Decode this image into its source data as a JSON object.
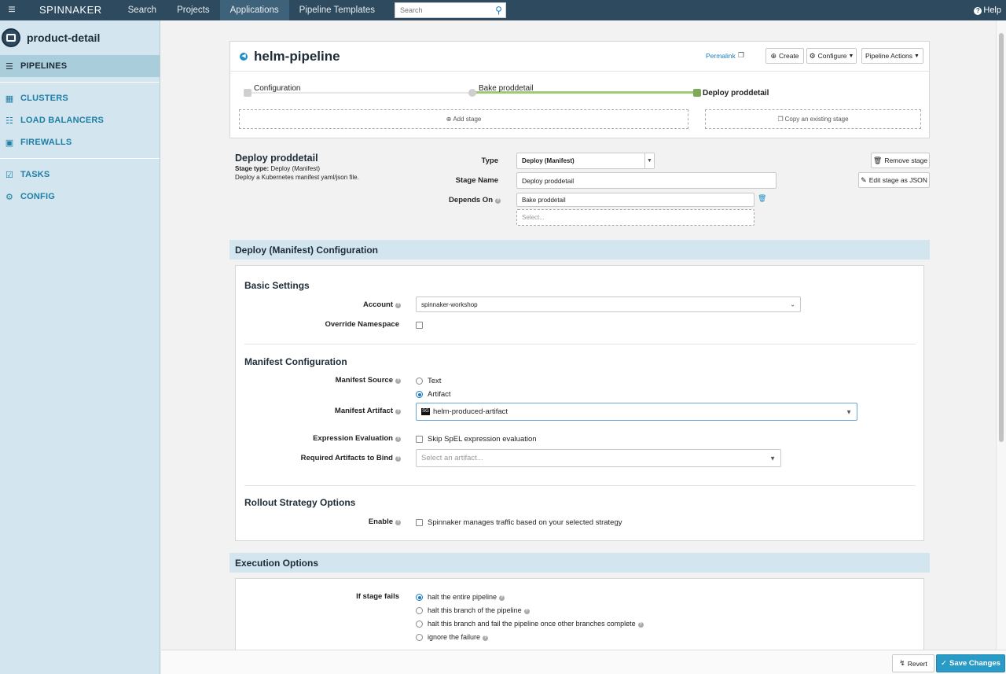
{
  "topnav": {
    "brand": "SPINNAKER",
    "items": [
      "Search",
      "Projects",
      "Applications",
      "Pipeline Templates"
    ],
    "active_item": "Applications",
    "search_placeholder": "Search",
    "help": "Help"
  },
  "sidebar": {
    "app_name": "product-detail",
    "items": [
      {
        "label": "PIPELINES",
        "icon": "list-icon"
      },
      {
        "label": "CLUSTERS",
        "icon": "grid-icon"
      },
      {
        "label": "LOAD BALANCERS",
        "icon": "sitemap-icon"
      },
      {
        "label": "FIREWALLS",
        "icon": "lock-icon"
      },
      {
        "label": "TASKS",
        "icon": "check-square-icon"
      },
      {
        "label": "CONFIG",
        "icon": "gear-icon"
      }
    ]
  },
  "pipeline": {
    "name": "helm-pipeline",
    "permalink": "Permalink",
    "create": "Create",
    "configure": "Configure",
    "actions": "Pipeline Actions",
    "stages": [
      {
        "label": "Configuration"
      },
      {
        "label": "Bake proddetail"
      },
      {
        "label": "Deploy proddetail"
      }
    ],
    "add_stage": "Add stage",
    "copy_stage": "Copy an existing stage"
  },
  "stage": {
    "title": "Deploy proddetail",
    "type_label": "Stage type:",
    "type_value": "Deploy (Manifest)",
    "description": "Deploy a Kubernetes manifest yaml/json file.",
    "labels": {
      "type": "Type",
      "name": "Stage Name",
      "depends": "Depends On"
    },
    "type_select": "Deploy (Manifest)",
    "name_value": "Deploy proddetail",
    "depends_value": "Bake proddetail",
    "depends_placeholder": "Select...",
    "remove": "Remove stage",
    "edit_json": "Edit stage as JSON"
  },
  "config": {
    "section_title": "Deploy (Manifest) Configuration",
    "basic": {
      "title": "Basic Settings",
      "account_label": "Account",
      "account_value": "spinnaker-workshop",
      "override_label": "Override Namespace"
    },
    "manifest": {
      "title": "Manifest Configuration",
      "source_label": "Manifest Source",
      "source_text": "Text",
      "source_artifact": "Artifact",
      "artifact_label": "Manifest Artifact",
      "artifact_badge": "SG",
      "artifact_value": "helm-produced-artifact",
      "expr_label": "Expression Evaluation",
      "expr_option": "Skip SpEL expression evaluation",
      "required_label": "Required Artifacts to Bind",
      "required_placeholder": "Select an artifact..."
    },
    "rollout": {
      "title": "Rollout Strategy Options",
      "enable_label": "Enable",
      "enable_option": "Spinnaker manages traffic based on your selected strategy"
    }
  },
  "execution": {
    "section_title": "Execution Options",
    "fail_label": "If stage fails",
    "options": [
      "halt the entire pipeline",
      "halt this branch of the pipeline",
      "halt this branch and fail the pipeline once other branches complete",
      "ignore the failure"
    ]
  },
  "footer": {
    "revert": "Revert",
    "save": "Save Changes"
  },
  "colors": {
    "nav": "#2d4a5e",
    "sidebar": "#d3e5ee",
    "accent": "#1b7bbd",
    "stage_green": "#7ea85a",
    "save": "#2a9bc7"
  }
}
